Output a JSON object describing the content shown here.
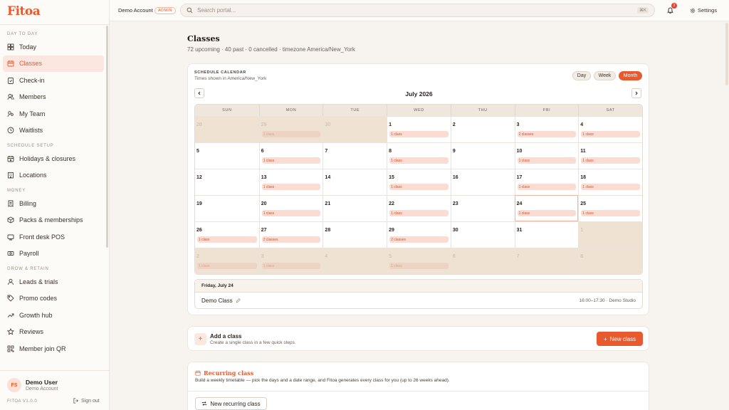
{
  "app": {
    "logo": "Fitoa"
  },
  "topbar": {
    "account": "Demo Account",
    "role_badge": "ADMIN",
    "search_placeholder": "Search portal...",
    "search_shortcut": "⌘K",
    "notification_count": "2",
    "settings_label": "Settings"
  },
  "sidebar": {
    "sections": [
      {
        "title": "DAY TO DAY",
        "items": [
          {
            "label": "Today",
            "icon": "grid-icon",
            "active": false
          },
          {
            "label": "Classes",
            "icon": "calendar-icon",
            "active": true
          },
          {
            "label": "Check-in",
            "icon": "clipboard-check-icon",
            "active": false
          },
          {
            "label": "Members",
            "icon": "members-icon",
            "active": false
          },
          {
            "label": "My Team",
            "icon": "team-icon",
            "active": false
          },
          {
            "label": "Waitlists",
            "icon": "clock-icon",
            "active": false
          }
        ]
      },
      {
        "title": "SCHEDULE SETUP",
        "items": [
          {
            "label": "Holidays & closures",
            "icon": "calendar-x-icon",
            "active": false
          },
          {
            "label": "Locations",
            "icon": "building-icon",
            "active": false
          }
        ]
      },
      {
        "title": "MONEY",
        "items": [
          {
            "label": "Billing",
            "icon": "receipt-icon",
            "active": false
          },
          {
            "label": "Packs & memberships",
            "icon": "package-icon",
            "active": false
          },
          {
            "label": "Front desk POS",
            "icon": "pos-icon",
            "active": false
          },
          {
            "label": "Payroll",
            "icon": "money-icon",
            "active": false
          }
        ]
      },
      {
        "title": "GROW & RETAIN",
        "items": [
          {
            "label": "Leads & trials",
            "icon": "user-icon",
            "active": false
          },
          {
            "label": "Promo codes",
            "icon": "tag-icon",
            "active": false
          },
          {
            "label": "Growth hub",
            "icon": "trend-icon",
            "active": false
          },
          {
            "label": "Reviews",
            "icon": "star-icon",
            "active": false
          },
          {
            "label": "Member join QR",
            "icon": "qr-icon",
            "active": false
          }
        ]
      }
    ],
    "user": {
      "initials": "FS",
      "name": "Demo User",
      "account": "Demo Account"
    },
    "version": "FITOA V1.0.0",
    "signout_label": "Sign out"
  },
  "page": {
    "title": "Classes",
    "subtitle": "72 upcoming · 40 past · 0 cancelled · timezone America/New_York"
  },
  "calendar": {
    "label": "SCHEDULE CALENDAR",
    "timezone_note": "Times shown in America/New_York",
    "views": [
      "Day",
      "Week",
      "Month"
    ],
    "active_view": "Month",
    "month_title": "July 2026",
    "weekdays": [
      "SUN",
      "MON",
      "TUE",
      "WED",
      "THU",
      "FRI",
      "SAT"
    ],
    "days": [
      {
        "n": "28",
        "out": true
      },
      {
        "n": "29",
        "out": true,
        "chip": "1 class"
      },
      {
        "n": "30",
        "out": true
      },
      {
        "n": "1",
        "chip": "1 class"
      },
      {
        "n": "2"
      },
      {
        "n": "3",
        "chip": "2 classes"
      },
      {
        "n": "4",
        "chip": "1 class"
      },
      {
        "n": "5"
      },
      {
        "n": "6",
        "chip": "1 class"
      },
      {
        "n": "7"
      },
      {
        "n": "8",
        "chip": "1 class"
      },
      {
        "n": "9"
      },
      {
        "n": "10",
        "chip": "1 class"
      },
      {
        "n": "11",
        "chip": "1 class"
      },
      {
        "n": "12"
      },
      {
        "n": "13",
        "chip": "1 class"
      },
      {
        "n": "14"
      },
      {
        "n": "15",
        "chip": "1 class"
      },
      {
        "n": "16"
      },
      {
        "n": "17",
        "chip": "1 class"
      },
      {
        "n": "18",
        "chip": "1 class"
      },
      {
        "n": "19"
      },
      {
        "n": "20",
        "chip": "1 class"
      },
      {
        "n": "21"
      },
      {
        "n": "22",
        "chip": "1 class"
      },
      {
        "n": "23"
      },
      {
        "n": "24",
        "chip": "1 class",
        "today": true
      },
      {
        "n": "25",
        "chip": "1 class"
      },
      {
        "n": "26",
        "chip": "1 class"
      },
      {
        "n": "27",
        "chip": "2 classes"
      },
      {
        "n": "28"
      },
      {
        "n": "29",
        "chip": "2 classes"
      },
      {
        "n": "30"
      },
      {
        "n": "31"
      },
      {
        "n": "1",
        "out": true
      },
      {
        "n": "2",
        "out": true,
        "chip": "1 class"
      },
      {
        "n": "3",
        "out": true,
        "chip": "1 class"
      },
      {
        "n": "4",
        "out": true
      },
      {
        "n": "5",
        "out": true,
        "chip": "1 class"
      },
      {
        "n": "6",
        "out": true
      },
      {
        "n": "7",
        "out": true
      },
      {
        "n": "8",
        "out": true
      }
    ],
    "selected_day": {
      "heading": "Friday, July 24",
      "class_name": "Demo Class",
      "time_location": "16:00–17:30 · Demo Studio"
    }
  },
  "add_class": {
    "title": "Add a class",
    "subtitle": "Create a single class in a few quick steps.",
    "button": "New class"
  },
  "recurring": {
    "title": "Recurring class",
    "subtitle": "Build a weekly timetable — pick the days and a date range, and Fitoa generates every class for you (up to 26 weeks ahead).",
    "button": "New recurring class"
  },
  "colors": {
    "accent": "#e85a2e",
    "chip_bg": "#fbdcd3",
    "outside_day": "#efe2d3"
  }
}
